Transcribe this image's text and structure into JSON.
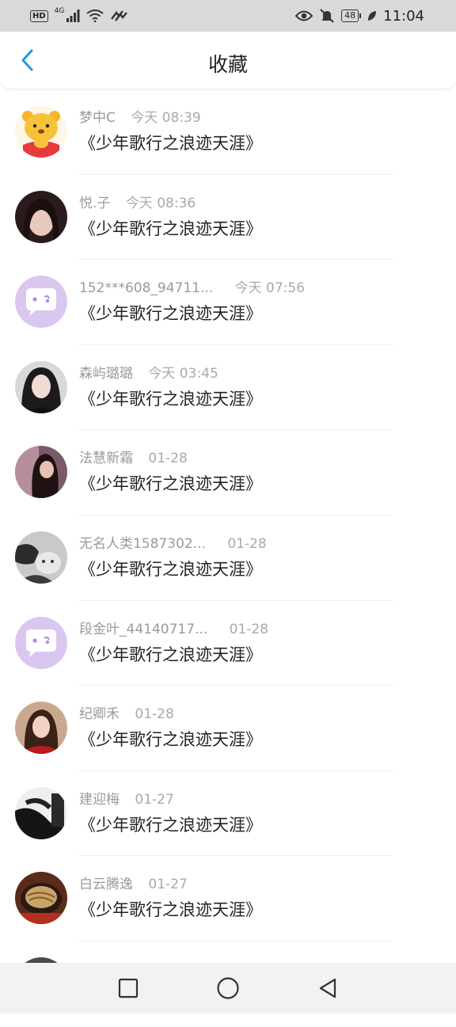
{
  "status_bar": {
    "hd": "HD",
    "network": "4G",
    "battery": "48",
    "time": "11:04",
    "icons": [
      "hd-icon",
      "signal-icon",
      "wifi-icon",
      "data-saver-icon",
      "eye-icon",
      "mute-icon",
      "battery-icon",
      "leaf-icon"
    ]
  },
  "header": {
    "title": "收藏",
    "back_icon": "chevron-left-icon"
  },
  "colors": {
    "accent": "#1a9be8",
    "placeholder_avatar": "#d9c7f0"
  },
  "items": [
    {
      "name": "梦中C",
      "time": "今天 08:39",
      "content": "《少年歌行之浪迹天涯》",
      "avatar": "winnie-bear"
    },
    {
      "name": "悦.子",
      "time": "今天 08:36",
      "content": "《少年歌行之浪迹天涯》",
      "avatar": "photo"
    },
    {
      "name": "152***608_94711...",
      "time": "今天 07:56",
      "content": "《少年歌行之浪迹天涯》",
      "avatar": "default-chat"
    },
    {
      "name": "森屿璐璐",
      "time": "今天 03:45",
      "content": "《少年歌行之浪迹天涯》",
      "avatar": "photo"
    },
    {
      "name": "法慧新霜",
      "time": "01-28",
      "content": "《少年歌行之浪迹天涯》",
      "avatar": "photo"
    },
    {
      "name": "无名人类1587302...",
      "time": "01-28",
      "content": "《少年歌行之浪迹天涯》",
      "avatar": "photo"
    },
    {
      "name": "段金叶_44140717...",
      "time": "01-28",
      "content": "《少年歌行之浪迹天涯》",
      "avatar": "default-chat"
    },
    {
      "name": "纪卿禾",
      "time": "01-28",
      "content": "《少年歌行之浪迹天涯》",
      "avatar": "photo"
    },
    {
      "name": "建迎梅",
      "time": "01-27",
      "content": "《少年歌行之浪迹天涯》",
      "avatar": "photo"
    },
    {
      "name": "白云腾逸",
      "time": "01-27",
      "content": "《少年歌行之浪迹天涯》",
      "avatar": "photo"
    }
  ],
  "navbar": {
    "icons": [
      "recent-apps-icon",
      "home-icon",
      "back-icon"
    ]
  }
}
